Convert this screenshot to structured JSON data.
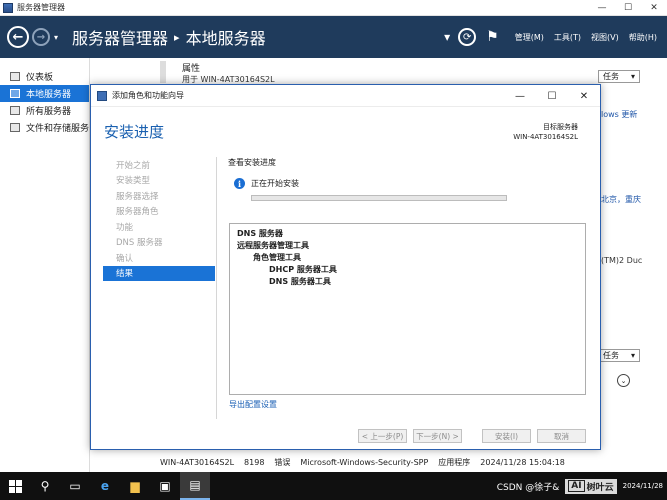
{
  "window": {
    "title": "服务器管理器",
    "ctrl_min": "—",
    "ctrl_max": "☐",
    "ctrl_close": "✕"
  },
  "header": {
    "back": "←",
    "forward": "→",
    "dropdown": "▾",
    "crumb_root": "服务器管理器",
    "crumb_sep": "▸",
    "crumb_current": "本地服务器",
    "menus": [
      "管理(M)",
      "工具(T)",
      "视图(V)",
      "帮助(H)"
    ]
  },
  "left_nav": {
    "items": [
      {
        "label": "仪表板",
        "active": false
      },
      {
        "label": "本地服务器",
        "active": true
      },
      {
        "label": "所有服务器",
        "active": false
      },
      {
        "label": "文件和存储服务",
        "active": false
      }
    ]
  },
  "background": {
    "prop_title": "属性",
    "prop_for": "用于 WIN-4AT30164S2L",
    "task_label": "任务",
    "frag_dows": "lows 更新",
    "frag_beijing": "北京，重庆",
    "frag_tm": "(TM)2 Duc",
    "row": [
      "WIN-4AT30164S2L",
      "8198",
      "错误",
      "Microsoft-Windows-Security-SPP",
      "应用程序",
      "2024/11/28 15:04:18"
    ]
  },
  "dialog": {
    "title": "添加角色和功能向导",
    "heading": "安装进度",
    "dest_label": "目标服务器",
    "dest_server": "WIN-4AT30164S2L",
    "steps": [
      "开始之前",
      "安装类型",
      "服务器选择",
      "服务器角色",
      "功能",
      "DNS 服务器",
      "确认",
      "结果"
    ],
    "active_step": 7,
    "section_label": "查看安装进度",
    "status_text": "正在开始安装",
    "progress": 0,
    "results": [
      {
        "text": "DNS 服务器",
        "level": 1
      },
      {
        "text": "远程服务器管理工具",
        "level": 1
      },
      {
        "text": "角色管理工具",
        "level": 2
      },
      {
        "text": "DHCP 服务器工具",
        "level": 3
      },
      {
        "text": "DNS 服务器工具",
        "level": 3
      }
    ],
    "export_link": "导出配置设置",
    "buttons": {
      "prev": "< 上一步(P)",
      "next": "下一步(N) >",
      "install": "安装(I)",
      "cancel": "取消"
    }
  },
  "taskbar": {
    "tray_text": "CSDN @徐子&",
    "clock_date": "2024/11/28",
    "watermark": "树叶云"
  },
  "colors": {
    "accent": "#1a73d6",
    "header_bg": "#1f3b5c",
    "heading_blue": "#1a60b0"
  }
}
